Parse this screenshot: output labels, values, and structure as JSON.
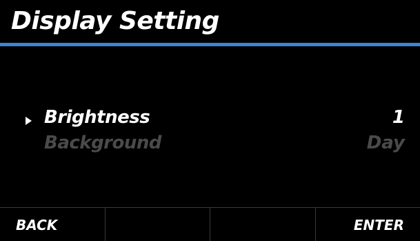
{
  "header": {
    "title": "Display Setting",
    "accent_color": "#3b86d4"
  },
  "menu": {
    "cursor_icon": "triangle-right-icon",
    "selected_color": "#ffffff",
    "dimmed_color": "#4a4a4a",
    "items": [
      {
        "label": "Brightness",
        "value": "1",
        "selected": true
      },
      {
        "label": "Background",
        "value": "Day",
        "selected": false
      }
    ]
  },
  "softkeys": [
    {
      "label": "BACK"
    },
    {
      "label": ""
    },
    {
      "label": ""
    },
    {
      "label": "ENTER"
    }
  ]
}
